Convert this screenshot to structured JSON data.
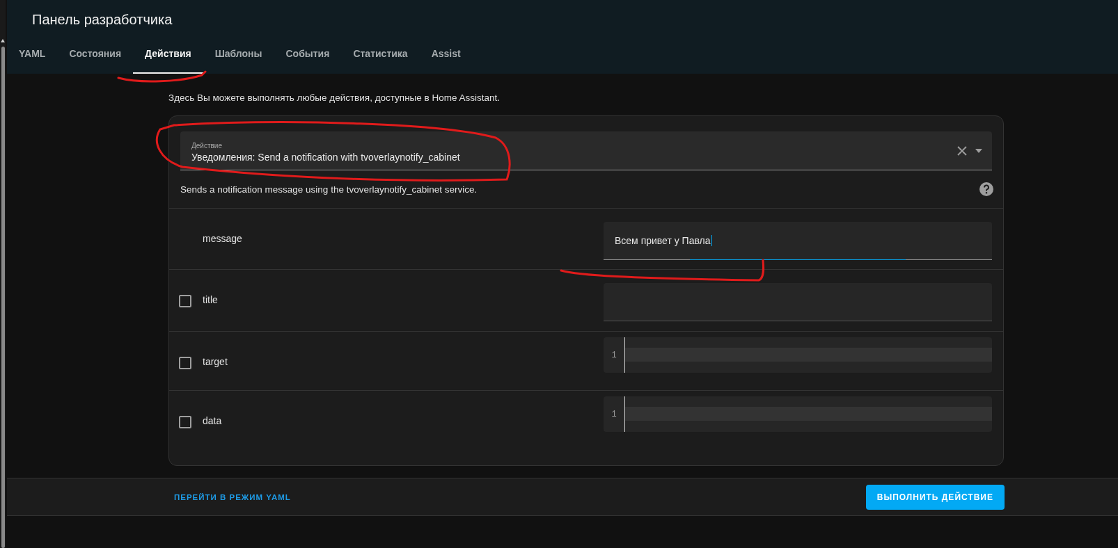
{
  "header": {
    "title": "Панель разработчика"
  },
  "tabs": [
    {
      "label": "YAML",
      "selected": false
    },
    {
      "label": "Состояния",
      "selected": false
    },
    {
      "label": "Действия",
      "selected": true
    },
    {
      "label": "Шаблоны",
      "selected": false
    },
    {
      "label": "События",
      "selected": false
    },
    {
      "label": "Статистика",
      "selected": false
    },
    {
      "label": "Assist",
      "selected": false
    }
  ],
  "intro": "Здесь Вы можете выполнять любые действия, доступные в Home Assistant.",
  "action_field": {
    "label": "Действие",
    "value": "Уведомления: Send a notification with tvoverlaynotify_cabinet"
  },
  "action_description": "Sends a notification message using the tvoverlaynotify_cabinet service.",
  "fields": [
    {
      "name": "message",
      "kind": "text",
      "optional": false,
      "value": "Всем привет у Павла",
      "focused": true
    },
    {
      "name": "title",
      "kind": "text",
      "optional": true,
      "checked": false,
      "focused": false
    },
    {
      "name": "target",
      "kind": "code",
      "optional": true,
      "checked": false,
      "line_number": "1"
    },
    {
      "name": "data",
      "kind": "code",
      "optional": true,
      "checked": false,
      "line_number": "1"
    }
  ],
  "footer": {
    "yaml_link": "ПЕРЕЙТИ В РЕЖИМ YAML",
    "run_button": "ВЫПОЛНИТЬ ДЕЙСТВИЕ"
  }
}
